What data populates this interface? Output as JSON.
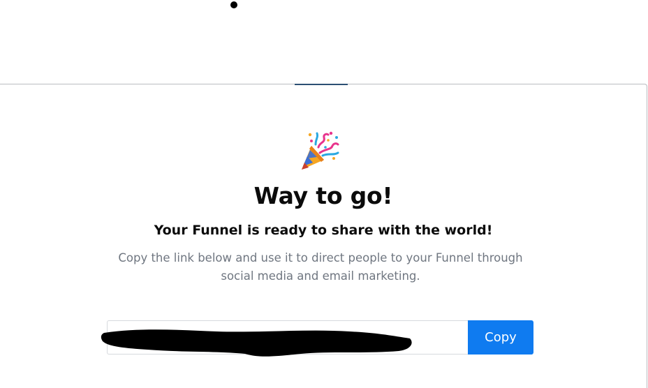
{
  "modal": {
    "icon": "party-popper-icon",
    "title": "Way to go!",
    "subtitle": "Your Funnel is ready to share with the world!",
    "description": "Copy the link below and use it to direct people to your Funnel through social media and email marketing."
  },
  "link": {
    "value": "",
    "copy_label": "Copy"
  },
  "colors": {
    "accent": "#0f7bf0",
    "title": "#0b0b0b",
    "muted_text": "#6f7680",
    "input_border": "#d6d9dd"
  }
}
